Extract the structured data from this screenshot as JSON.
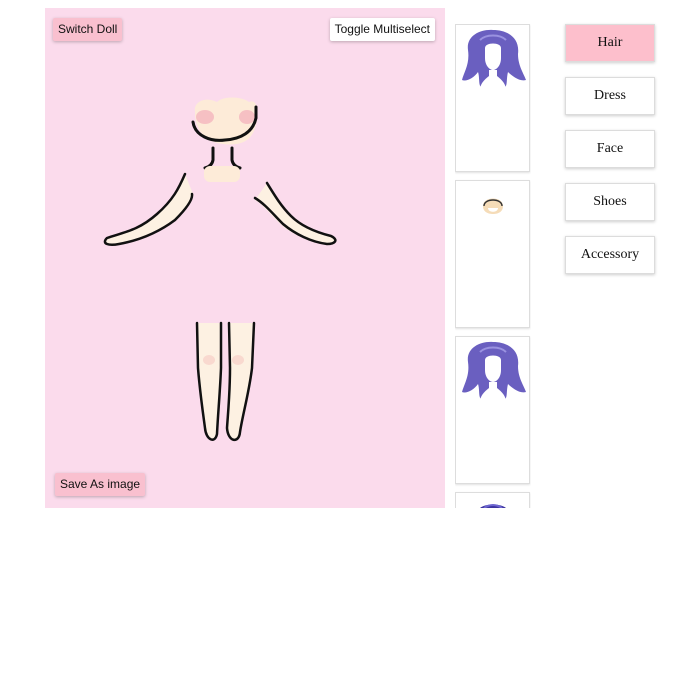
{
  "canvas": {
    "switch_doll_label": "Switch Doll",
    "toggle_multiselect_label": "Toggle Multiselect",
    "save_image_label": "Save As image",
    "background_color": "#fbdbec"
  },
  "thumbnails": [
    {
      "item": "hair-purple-long-icon"
    },
    {
      "item": "hair-short-icon"
    },
    {
      "item": "hair-purple-long-icon"
    },
    {
      "item": "hair-purple-icon"
    }
  ],
  "categories": {
    "hair": "Hair",
    "dress": "Dress",
    "face": "Face",
    "shoes": "Shoes",
    "accessory": "Accessory",
    "active": "Hair",
    "active_color": "#fdbfcc"
  }
}
